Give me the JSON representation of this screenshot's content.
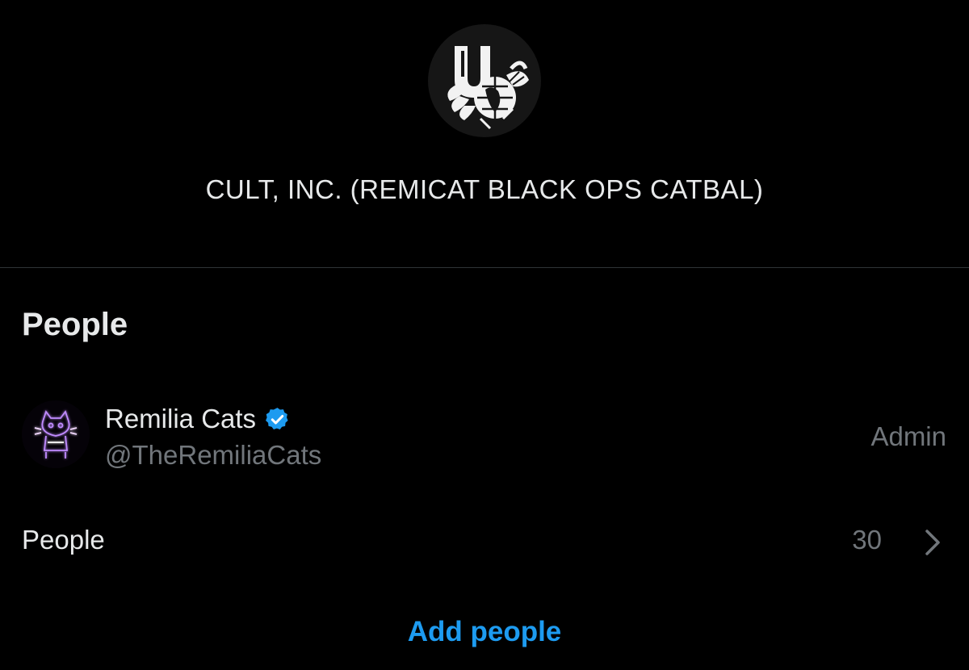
{
  "group": {
    "avatar_icon": "cult-inc-emblem-icon",
    "name": "CULT, INC. (REMICAT BLACK OPS CATBAL)"
  },
  "people_section": {
    "title": "People",
    "members": [
      {
        "display_name": "Remilia Cats",
        "handle": "@TheRemiliaCats",
        "role": "Admin",
        "verified": true,
        "avatar_icon": "neon-cat-avatar-icon"
      }
    ],
    "people_row": {
      "label": "People",
      "count": "30"
    },
    "add_people_label": "Add people"
  },
  "colors": {
    "background": "#000000",
    "primary_text": "#e7e9ea",
    "secondary_text": "#71767b",
    "accent": "#1d9bf0",
    "divider": "#2f3336"
  }
}
